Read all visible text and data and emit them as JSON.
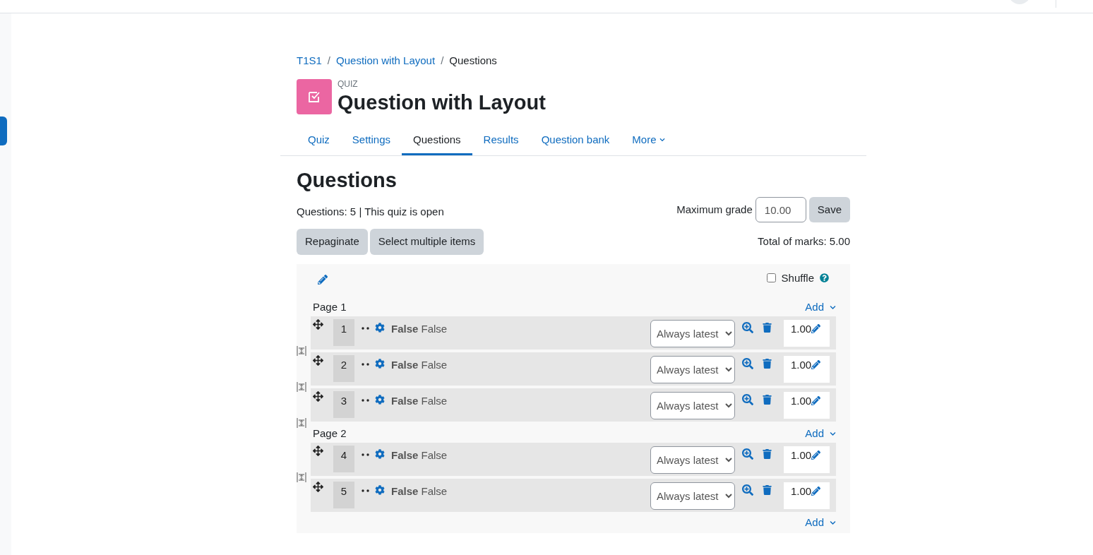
{
  "breadcrumbs": [
    {
      "label": "T1S1",
      "link": true
    },
    {
      "label": "Question with Layout",
      "link": true
    },
    {
      "label": "Questions",
      "link": false
    }
  ],
  "breadcrumb_separator": "/",
  "activity": {
    "type": "QUIZ",
    "title": "Question with Layout"
  },
  "tabs": [
    {
      "label": "Quiz",
      "selected": false
    },
    {
      "label": "Settings",
      "selected": false
    },
    {
      "label": "Questions",
      "selected": true
    },
    {
      "label": "Results",
      "selected": false
    },
    {
      "label": "Question bank",
      "selected": false
    },
    {
      "label": "More",
      "selected": false,
      "menu": true
    }
  ],
  "heading": "Questions",
  "summary": "Questions: 5 | This quiz is open",
  "max_grade": {
    "label": "Maximum grade",
    "value": "10.00",
    "button": "Save"
  },
  "buttons": [
    "Repaginate",
    "Select multiple items"
  ],
  "total_marks": "Total of marks: 5.00",
  "shuffle": {
    "label": "Shuffle",
    "checked": false
  },
  "pages": [
    {
      "label": "Page 1",
      "add": "Add",
      "slots": [
        {
          "number": "1",
          "name": "**False** False",
          "version": "Always latest",
          "mark": "1.00"
        },
        {
          "number": "2",
          "name": "**False** False",
          "version": "Always latest",
          "mark": "1.00"
        },
        {
          "number": "3",
          "name": "**False** False",
          "version": "Always latest",
          "mark": "1.00"
        }
      ]
    },
    {
      "label": "Page 2",
      "add": "Add",
      "slots": [
        {
          "number": "4",
          "name": "**False** False",
          "version": "Always latest",
          "mark": "1.00"
        },
        {
          "number": "5",
          "name": "**False** False",
          "version": "Always latest",
          "mark": "1.00"
        }
      ]
    }
  ],
  "final_add": "Add"
}
